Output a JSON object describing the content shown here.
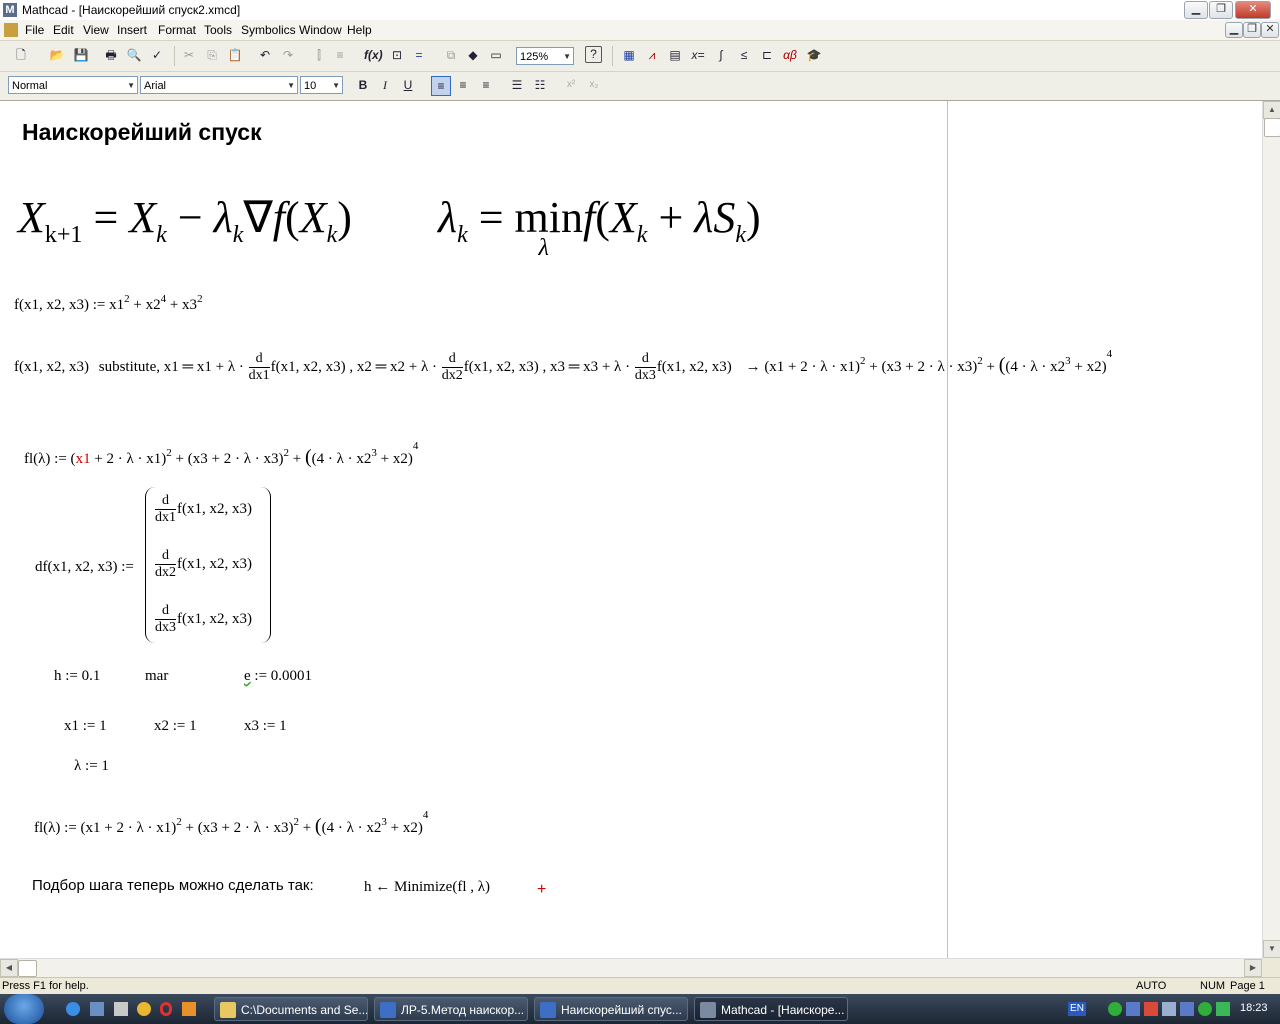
{
  "window": {
    "title": "Mathcad - [Наискорейший спуск2.xmcd]",
    "app_icon": "M"
  },
  "menu": [
    "File",
    "Edit",
    "View",
    "Insert",
    "Format",
    "Tools",
    "Symbolics",
    "Window",
    "Help"
  ],
  "toolbar": {
    "zoom": "125%",
    "style": "Normal",
    "font": "Arial",
    "size": "10"
  },
  "document": {
    "heading": "Наискорейший спуск",
    "formula_iteration": {
      "X": "X",
      "k1": "k+1",
      "k": "k",
      "minus": "−",
      "lambda": "λ",
      "nabla": "∇",
      "f": "f"
    },
    "formula_min": {
      "lambda": "λ",
      "k": "k",
      "eq": "=",
      "min": "min",
      "min_sub": "λ",
      "f": "f",
      "X": "X",
      "plus": "+",
      "S": "S"
    },
    "f_def": "f(x1, x2, x3) := x1",
    "f_def_parts": {
      "p1": "f(x1, x2, x3) := x1",
      "e1": "2",
      "p2": " + x2",
      "e2": "4",
      "p3": " + x3",
      "e3": "2"
    },
    "subst": {
      "lhs": "f(x1, x2, x3)",
      "kw": "substitute,",
      "a": "x1 ═ x1 + λ ·",
      "b": "f(x1, x2, x3) , x2 ═ x2 + λ ·",
      "c": "f(x1, x2, x3) , x3 ═ x3 + λ ·",
      "d": "f(x1, x2, x3)",
      "d1": "d",
      "dx1": "dx1",
      "dx2": "dx2",
      "dx3": "dx3",
      "result": "→ (x1 + 2 · λ · x1)",
      "r2": " + (x3 + 2 · λ · x3)",
      "r3": " + ",
      "r4": "(4 · λ · x2",
      "r5": " + x2)",
      "two": "2",
      "three": "3",
      "four": "4"
    },
    "fl1": {
      "lhs": "fl(λ) := (",
      "x1": "x1",
      "rest": " + 2 · λ · x1)",
      "mid": " + (x3 + 2 · λ · x3)",
      "p": " + ",
      "paren": "(4 · λ · x2",
      "end": " + x2)"
    },
    "df": {
      "lhs": "df(x1, x2, x3) :=",
      "d": "d",
      "row": "f(x1, x2, x3)",
      "dx1": "dx1",
      "dx2": "dx2",
      "dx3": "dx3"
    },
    "h": "h := 0.1",
    "mar": "mar",
    "e_name": "e",
    "e_val": " := 0.0001",
    "x1": "x1 := 1",
    "x2": "x2 := 1",
    "x3": "x3 := 1",
    "lambda": "λ := 1",
    "fl2": {
      "lhs": "fl(λ) := (x1 + 2 · λ · x1)",
      "mid": " + (x3 + 2 · λ · x3)",
      "p": " + ",
      "paren": "(4 · λ · x2",
      "end": " + x2)"
    },
    "step_text": "Подбор шага теперь можно сделать так:",
    "minimize": "h ← Minimize(fl , λ)",
    "cursor": "+"
  },
  "status": {
    "help": "Press F1 for help.",
    "auto": "AUTO",
    "num": "NUM",
    "page": "Page 1"
  },
  "taskbar": {
    "tasks": [
      "C:\\Documents and Se...",
      "ЛР-5.Метод наискор...",
      "Наискорейший спус...",
      "Mathcad - [Наискоре..."
    ],
    "lang": "EN",
    "time": "18:23"
  }
}
